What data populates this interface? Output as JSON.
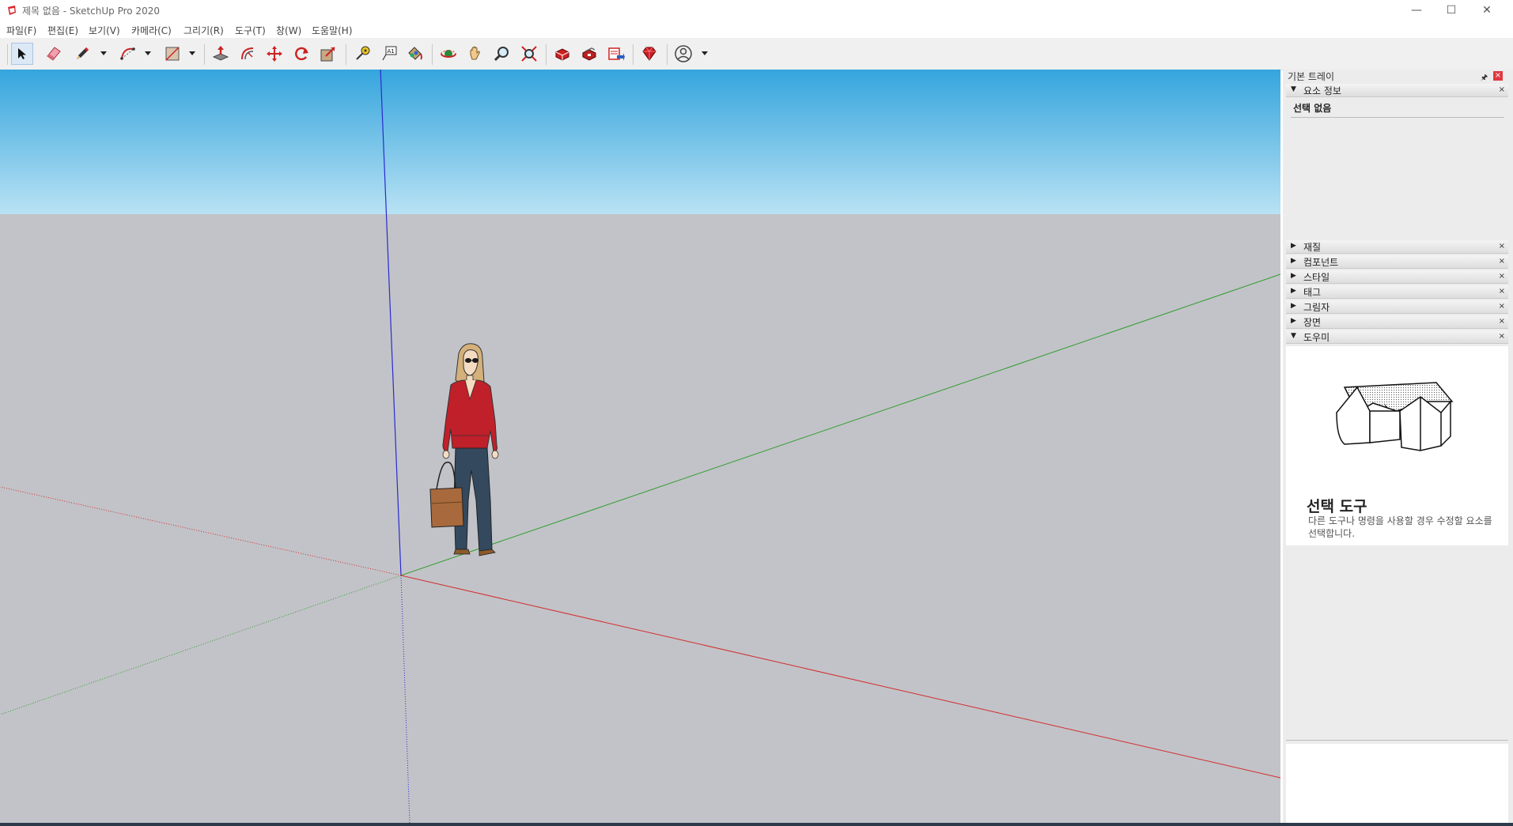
{
  "window": {
    "title": "제목 없음 - SketchUp Pro 2020",
    "app_icon": "sketchup-logo-icon",
    "controls": {
      "minimize": "—",
      "maximize": "☐",
      "close": "✕"
    }
  },
  "menu": {
    "items": [
      "파일(F)",
      "편집(E)",
      "보기(V)",
      "카메라(C)",
      "그리기(R)",
      "도구(T)",
      "창(W)",
      "도움말(H)"
    ]
  },
  "toolbar": {
    "tools": [
      {
        "name": "select-tool",
        "icon": "arrow-cursor-icon",
        "active": true
      },
      {
        "name": "eraser-tool",
        "icon": "eraser-icon"
      },
      {
        "name": "line-tool",
        "icon": "pencil-icon",
        "dropdown": true
      },
      {
        "name": "arc-tool",
        "icon": "arc-icon",
        "dropdown": true
      },
      {
        "name": "shape-tool",
        "icon": "rectangle-icon",
        "dropdown": true
      },
      {
        "name": "push-pull-tool",
        "icon": "push-pull-icon"
      },
      {
        "name": "offset-tool",
        "icon": "offset-icon"
      },
      {
        "name": "move-tool",
        "icon": "move-icon"
      },
      {
        "name": "rotate-tool",
        "icon": "rotate-icon"
      },
      {
        "name": "scale-tool",
        "icon": "scale-icon"
      },
      {
        "name": "tape-measure-tool",
        "icon": "tape-measure-icon"
      },
      {
        "name": "text-tool",
        "icon": "text-icon"
      },
      {
        "name": "paint-bucket-tool",
        "icon": "paint-bucket-icon"
      },
      {
        "name": "orbit-tool",
        "icon": "orbit-icon"
      },
      {
        "name": "pan-tool",
        "icon": "hand-icon"
      },
      {
        "name": "zoom-tool",
        "icon": "magnifier-icon"
      },
      {
        "name": "zoom-extents-tool",
        "icon": "zoom-extents-icon"
      },
      {
        "name": "warehouse-tool",
        "icon": "3d-warehouse-icon"
      },
      {
        "name": "extension-warehouse-tool",
        "icon": "extension-warehouse-icon"
      },
      {
        "name": "send-to-layout-tool",
        "icon": "layout-icon"
      },
      {
        "name": "extension-manager-tool",
        "icon": "ruby-gem-icon"
      },
      {
        "name": "account-tool",
        "icon": "user-account-icon",
        "dropdown": true
      }
    ]
  },
  "tray": {
    "title": "기본 트레이",
    "pin": "🖈",
    "close": "×",
    "entity_info": {
      "label": "요소 정보",
      "expanded": true,
      "value": "선택 없음"
    },
    "panels": [
      {
        "label": "재질",
        "expanded": false
      },
      {
        "label": "컴포넌트",
        "expanded": false
      },
      {
        "label": "스타일",
        "expanded": false
      },
      {
        "label": "태그",
        "expanded": false
      },
      {
        "label": "그림자",
        "expanded": false
      },
      {
        "label": "장면",
        "expanded": false
      },
      {
        "label": "도우미",
        "expanded": true
      }
    ],
    "instructor": {
      "title": "선택 도구",
      "description": "다른 도구나 명령을 사용할 경우 수정할 요소를 선택합니다."
    },
    "panel_close": "×",
    "arrow_collapsed": "▶",
    "arrow_expanded": "▼"
  },
  "colors": {
    "sky_top": "#35a5dd",
    "sky_bottom": "#b9e2f4",
    "ground": "#c2c3c8",
    "axis_red": "#d22d2d",
    "axis_green": "#2e9d2e",
    "axis_blue": "#2a2ad0"
  }
}
